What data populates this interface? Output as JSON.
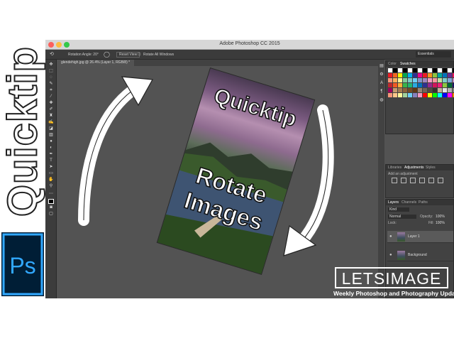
{
  "banner": {
    "vertical_title": "Quicktip",
    "logo_text": "Ps"
  },
  "app": {
    "title": "Adobe Photoshop CC 2015",
    "workspace": "Essentials"
  },
  "options_bar": {
    "rotation_label": "Rotation Angle: 20°",
    "reset_view": "Reset View",
    "rotate_all_windows": "Rotate All Windows"
  },
  "document_tab": "glendehigh.jpg @ 26.4% (Layer 1, RGB/8) *",
  "panels": {
    "color_tabs": [
      "Color",
      "Swatches"
    ],
    "adjustments_tabs": [
      "Libraries",
      "Adjustments",
      "Styles"
    ],
    "add_adjustment": "Add an adjustment",
    "layers_tabs": [
      "Layers",
      "Channels",
      "Paths"
    ],
    "layers_filter": "Kind",
    "blend_mode": "Normal",
    "opacity_label": "Opacity:",
    "opacity_value": "100%",
    "lock_label": "Lock:",
    "fill_label": "Fill:",
    "fill_value": "100%",
    "layers": [
      "Layer 1",
      "Background"
    ]
  },
  "photo_text": {
    "line1": "Quicktip",
    "line2": "Rotate",
    "line3": "Images"
  },
  "branding": {
    "name": "LETSIMAGE",
    "tagline": "Weekly Photoshop and Photography Updates"
  },
  "colors": {
    "ps_blue": "#31a8ff",
    "ps_bg": "#001e36",
    "workspace": "#535353",
    "panel": "#424242"
  },
  "swatches": [
    "#ffffff",
    "#000000",
    "#ffffff",
    "#000000",
    "#ffffff",
    "#000000",
    "#ffffff",
    "#000000",
    "#ffffff",
    "#000000",
    "#ffffff",
    "#000000",
    "#ffffff",
    "#000000",
    "#ed1c24",
    "#f26522",
    "#fff200",
    "#00a651",
    "#00aeef",
    "#2e3192",
    "#ec008c",
    "#ed1c24",
    "#f7941d",
    "#8dc63f",
    "#00a99d",
    "#0072bc",
    "#662d91",
    "#ed145b",
    "#f69679",
    "#fbaf5d",
    "#fff799",
    "#82ca9c",
    "#7accc8",
    "#6dcff6",
    "#8393ca",
    "#a186be",
    "#f49ac2",
    "#f6989d",
    "#c4df9b",
    "#7bcdc8",
    "#7da7d9",
    "#bd8cbf",
    "#c1272d",
    "#f15a24",
    "#fbb03b",
    "#39b54a",
    "#22b573",
    "#29abe2",
    "#0071bc",
    "#2e3192",
    "#93278f",
    "#d4145a",
    "#ed1e79",
    "#8cc63f",
    "#006837",
    "#1b1464",
    "#9e005d",
    "#c69c6d",
    "#a67c52",
    "#8c6239",
    "#754c24",
    "#603813",
    "#998675",
    "#736357",
    "#534741",
    "#362f2d",
    "#c7b299",
    "#e6e6e6",
    "#b3b3b3",
    "#808080",
    "#f7977a",
    "#fdc68a",
    "#fff79a",
    "#a2d39c",
    "#6ecff6",
    "#8781bd",
    "#f49ac1",
    "#ff0000",
    "#ffff00",
    "#00ff00",
    "#00ffff",
    "#0000ff",
    "#ff00ff",
    "#ff8000"
  ]
}
